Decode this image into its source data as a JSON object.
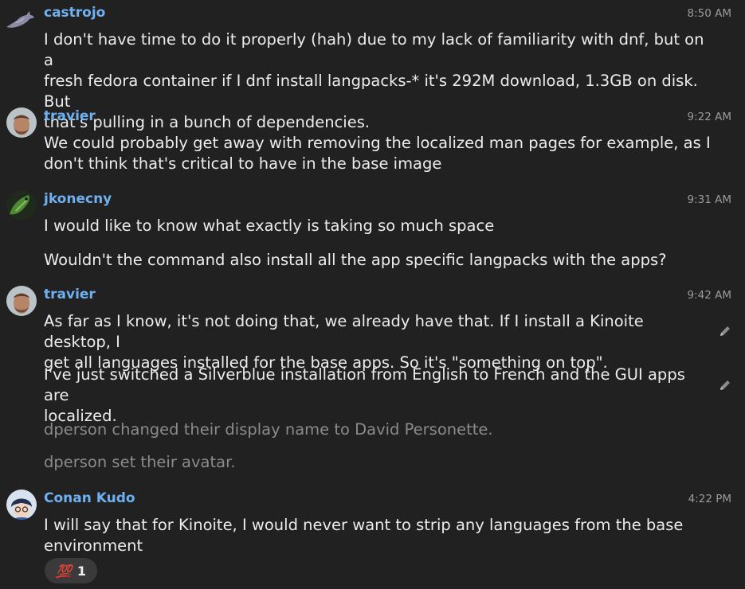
{
  "colors": {
    "background": "#212121",
    "author": "#6fb0f0",
    "notice": "#8b8b8b",
    "timestamp": "#9a9a9a"
  },
  "messages": [
    {
      "author": "castrojo",
      "time": "8:50 AM",
      "lines": [
        "I don't have time to do it properly (hah) due to my lack of familiarity with dnf, but on a",
        "fresh fedora container if I dnf install langpacks-* it's 292M download, 1.3GB on disk. But",
        "that's pulling in a bunch of dependencies."
      ]
    },
    {
      "author": "travier",
      "time": "9:22 AM",
      "lines": [
        "We could probably get away with removing the localized man pages for example, as I",
        "don't think that's critical to have in the base image"
      ]
    },
    {
      "author": "jkonecny",
      "time": "9:31 AM",
      "line1": "I would like to know what exactly is taking so much space",
      "line2": "Wouldn't the command also install all the app specific langpacks with the apps?"
    },
    {
      "author": "travier",
      "time": "9:42 AM",
      "p1": [
        "As far as I know, it's not doing that, we already have that. If I install a Kinoite desktop, I",
        "get all languages installed for the base apps. So it's \"something on top\"."
      ],
      "p2": [
        "I've just switched a Silverblue installation from English to French and the GUI apps are",
        "localized."
      ]
    },
    {
      "author": "Conan Kudo",
      "time": "4:22 PM",
      "lines": [
        "I will say that for Kinoite, I would never want to strip any languages from the base",
        "environment"
      ],
      "reaction": {
        "emoji": "💯",
        "emoji_name": "hundred-points",
        "count": "1"
      }
    }
  ],
  "notices": [
    "dperson changed their display name to David Personette.",
    "dperson set their avatar."
  ],
  "icons": {
    "edit": "pencil-icon"
  }
}
